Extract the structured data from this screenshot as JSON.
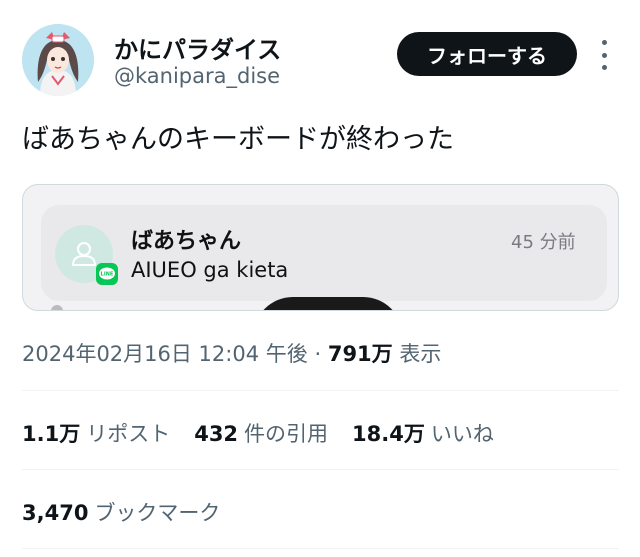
{
  "author": {
    "display_name": "かにパラダイス",
    "handle": "@kanipara_dise"
  },
  "follow_label": "フォローする",
  "more_icon": "more-options-icon",
  "tweet": {
    "text": "ばあちゃんのキーボードが終わった"
  },
  "media": {
    "notification": {
      "sender": "ばあちゃん",
      "time": "45 分前",
      "message": "AIUEO ga kieta",
      "app_icon": "line-app-icon",
      "app_icon_text": "LINE",
      "app_color": "#06c755"
    }
  },
  "meta": {
    "datetime": "2024年02月16日 12:04 午後",
    "separator": "·",
    "views_count": "791万",
    "views_label": "表示"
  },
  "stats": [
    {
      "count": "1.1万",
      "label": "リポスト"
    },
    {
      "count": "432",
      "label": "件の引用"
    },
    {
      "count": "18.4万",
      "label": "いいね"
    }
  ],
  "bookmarks": {
    "count": "3,470",
    "label": "ブックマーク"
  }
}
